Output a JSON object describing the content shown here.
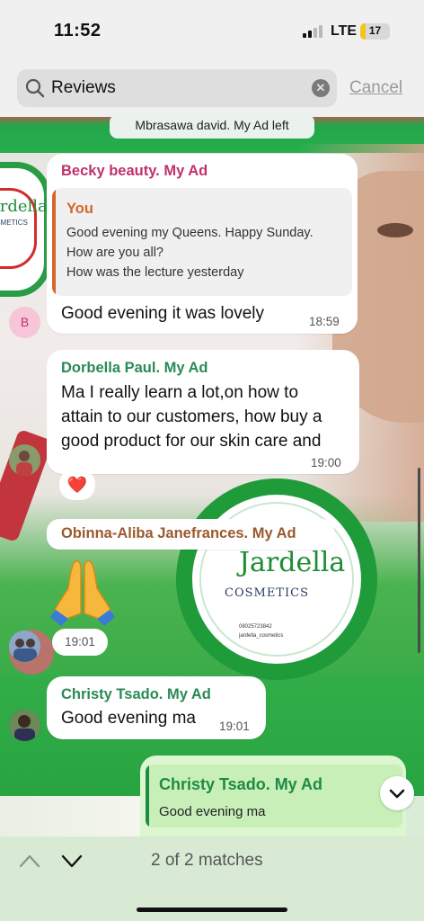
{
  "status_bar": {
    "time": "11:52",
    "network": "LTE",
    "battery_level": "17",
    "battery_fraction": 0.17
  },
  "search": {
    "query": "Reviews",
    "cancel_label": "Cancel"
  },
  "system_notice": "Mbrasawa david. My Ad left",
  "messages": [
    {
      "sender": "Becky beauty. My Ad",
      "sender_color": "#c2306b",
      "avatar_initial": "B",
      "reply_to": {
        "name": "You",
        "lines": [
          "Good evening my Queens. Happy Sunday.",
          "How are you all?",
          "How was the lecture yesterday"
        ]
      },
      "text": "Good  evening  it was  lovely",
      "time": "18:59"
    },
    {
      "sender": "Dorbella Paul. My Ad",
      "sender_color": "#2a8a56",
      "lines": [
        "Ma I really learn a lot,on how to",
        "attain to our customers, how buy a",
        "good product for our skin care and"
      ],
      "time": "19:00",
      "reaction": "❤️"
    },
    {
      "sender": "Obinna-Aliba Janefrances.  My Ad",
      "sender_color": "#9a5a2e",
      "emoji": "folded-hands",
      "time": "19:01"
    },
    {
      "sender": "Christy Tsado. My Ad",
      "sender_color": "#2a8a56",
      "text": "Good evening ma",
      "time": "19:01"
    }
  ],
  "outgoing_draft": {
    "reply_to_name": "Christy Tsado. My Ad",
    "reply_to_text": "Good evening ma"
  },
  "background_ad": {
    "brand": "Jardella",
    "brand_sub": "COSMETICS",
    "phone": "08025723842",
    "handle": "jardella_cosmetics",
    "left_logo_text": "ardella",
    "left_logo_sub": "OSMETICS"
  },
  "footer": {
    "match_text": "2 of 2 matches"
  },
  "colors": {
    "accent_green": "#1f9b3a",
    "quote_orange": "#d6652c",
    "bottom_bar": "#d9ead4"
  }
}
